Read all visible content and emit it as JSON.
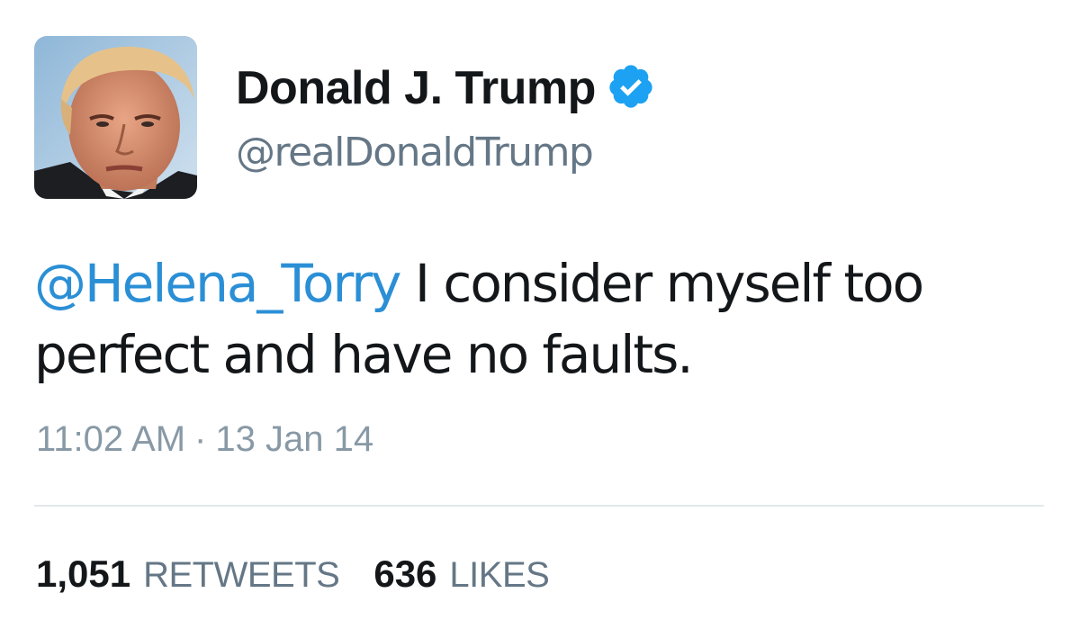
{
  "author": {
    "display_name": "Donald J. Trump",
    "handle": "@realDonaldTrump",
    "verified": true,
    "avatar_icon": "profile-photo"
  },
  "tweet": {
    "mention": "@Helena_Torry",
    "text": " I consider myself too perfect and have no faults.",
    "time": "11:02 AM",
    "separator": "·",
    "date": "13 Jan 14"
  },
  "stats": {
    "retweets_count": "1,051",
    "retweets_label": "RETWEETS",
    "likes_count": "636",
    "likes_label": "LIKES"
  },
  "colors": {
    "link": "#2b8fd6",
    "verified_badge": "#1da1f2",
    "secondary_text": "#657786",
    "timestamp_text": "#8899a6",
    "divider": "#e1e8ed"
  }
}
